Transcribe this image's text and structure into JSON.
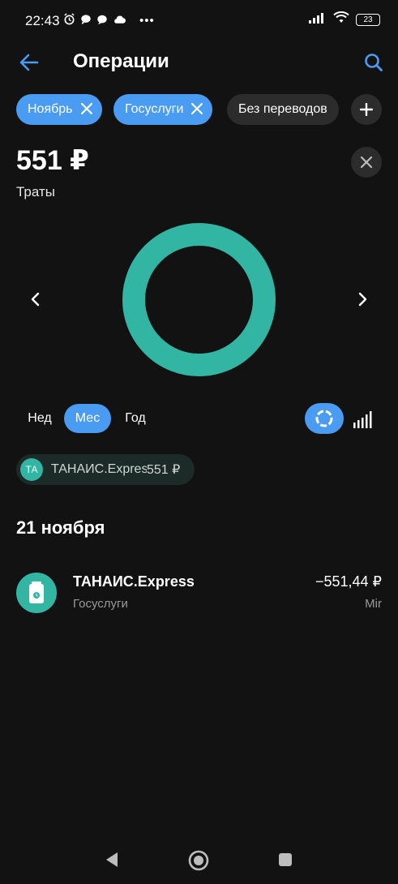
{
  "status_bar": {
    "time": "22:43",
    "battery": "23",
    "left_icons": [
      "alarm-icon",
      "chat-icon",
      "message-icon",
      "cloud-icon",
      "more-icon"
    ],
    "right_icons": [
      "signal-icon",
      "wifi-icon",
      "battery-icon"
    ]
  },
  "header": {
    "title": "Операции",
    "back_icon": "back-arrow-icon",
    "search_icon": "search-icon"
  },
  "filters": {
    "chips": [
      {
        "label": "Ноябрь",
        "active": true
      },
      {
        "label": "Госуслуги",
        "active": true
      },
      {
        "label": "Без переводов",
        "active": false
      }
    ],
    "add_icon": "plus-icon"
  },
  "summary": {
    "amount": "551 ₽",
    "label": "Траты"
  },
  "chart": {
    "type": "donut",
    "accent": "#33b5a3"
  },
  "period": {
    "options": [
      "Нед",
      "Мес",
      "Год"
    ],
    "selected": "Мес"
  },
  "merchant_chip": {
    "initials": "ТА",
    "name": "ТАНАИС.Express",
    "amount": "551 ₽"
  },
  "transactions": {
    "date": "21 ноября",
    "items": [
      {
        "title": "ТАНАИС.Express",
        "category": "Госуслуги",
        "amount": "−551,44 ₽",
        "card": "Mir"
      }
    ]
  },
  "colors": {
    "background": "#121212",
    "accent_blue": "#4a9bf2",
    "accent_teal": "#33b5a3"
  }
}
